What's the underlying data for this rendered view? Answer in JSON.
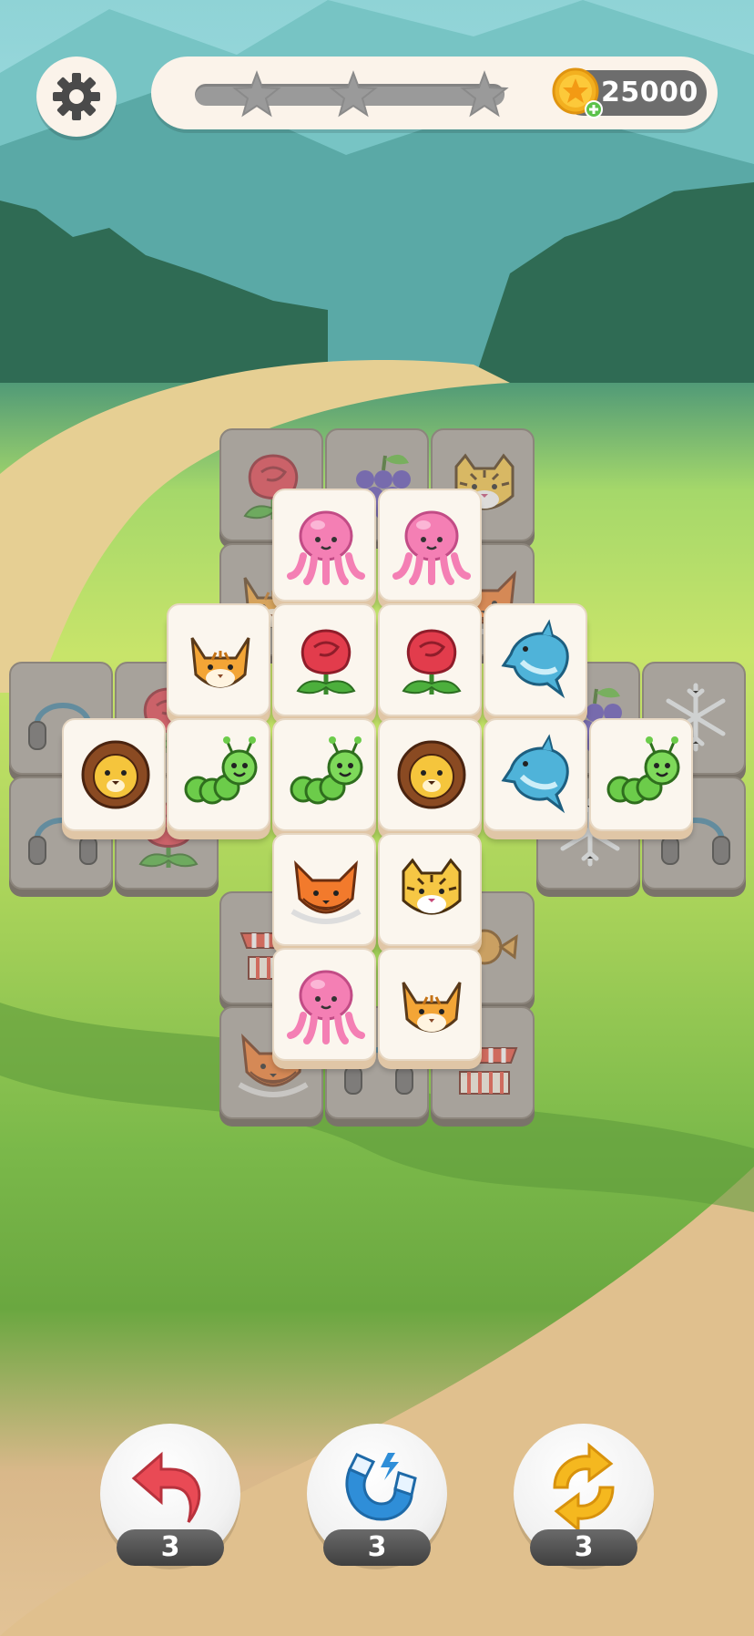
{
  "topbar": {
    "coins": "25000",
    "star_progress": 0.0,
    "stars_total": 3
  },
  "board": {
    "lower_layer": [
      {
        "icon": "rose-icon"
      },
      {
        "icon": "grapes-icon"
      },
      {
        "icon": "tiger-icon"
      },
      {
        "icon": "cat-icon"
      },
      {
        "icon": "fox-icon"
      },
      {
        "icon": "headphones-icon"
      },
      {
        "icon": "rose-icon"
      },
      {
        "icon": "grapes-icon"
      },
      {
        "icon": "snowflake-icon"
      },
      {
        "icon": "headphones-icon"
      },
      {
        "icon": "rose-icon"
      },
      {
        "icon": "snowflake-icon"
      },
      {
        "icon": "headphones-icon"
      },
      {
        "icon": "market-stall-icon"
      },
      {
        "icon": "candy-icon"
      },
      {
        "icon": "fox-icon"
      },
      {
        "icon": "headphones-icon"
      },
      {
        "icon": "market-stall-icon"
      }
    ],
    "upper_layer": [
      {
        "icon": "octopus-icon"
      },
      {
        "icon": "octopus-icon"
      },
      {
        "icon": "cat-icon"
      },
      {
        "icon": "rose-icon"
      },
      {
        "icon": "rose-icon"
      },
      {
        "icon": "dolphin-icon"
      },
      {
        "icon": "lion-icon"
      },
      {
        "icon": "caterpillar-icon"
      },
      {
        "icon": "caterpillar-icon"
      },
      {
        "icon": "lion-icon"
      },
      {
        "icon": "dolphin-icon"
      },
      {
        "icon": "caterpillar-icon"
      },
      {
        "icon": "fox-icon"
      },
      {
        "icon": "tiger-icon"
      },
      {
        "icon": "octopus-icon"
      },
      {
        "icon": "cat-icon"
      }
    ]
  },
  "powerups": [
    {
      "name": "undo",
      "icon": "undo-arrow-icon",
      "count": "3",
      "color": "#e94a55"
    },
    {
      "name": "magnet",
      "icon": "magnet-icon",
      "count": "3",
      "color": "#2f8ed8"
    },
    {
      "name": "shuffle",
      "icon": "shuffle-icon",
      "count": "3",
      "color": "#f5b81f"
    }
  ],
  "colors": {
    "tile_face": "#fbf6ee",
    "tile_shadow": "#e0c6a6",
    "lower_tile": "#a7a29b",
    "progress_track": "#9a9a9a",
    "coin_pill": "#6d6d6d"
  }
}
